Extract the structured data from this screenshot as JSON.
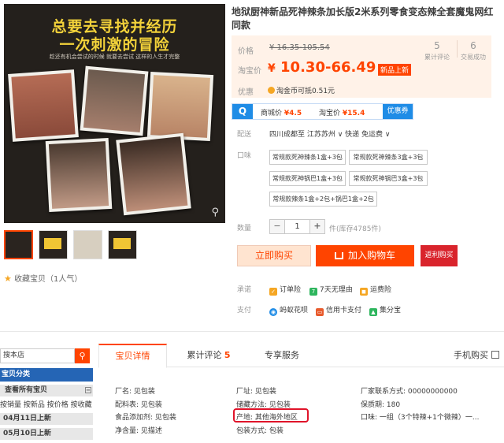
{
  "hero": {
    "line1": "总要去寻找并经历",
    "line2": "一次刺激的冒险",
    "sub": "趁还有机会尝试的时候 就要去尝试 这样的人生才完整"
  },
  "favorite": {
    "label": "收藏宝贝（1人气）"
  },
  "product": {
    "title": "地狱厨神新品死神辣条加长版2米系列零食变态辣全套魔鬼网红同款",
    "price_label": "价格",
    "original_price": "¥ 16.35-105.54",
    "promo_label": "淘宝价",
    "yen": "¥",
    "promo_price": "10.30-66.49",
    "new_badge": "新品上新",
    "offer_label": "优惠",
    "offer_text": "淘金币可抵0.51元",
    "stats": [
      {
        "num": "5",
        "label": "累计评论"
      },
      {
        "num": "6",
        "label": "交易成功"
      }
    ]
  },
  "compare": {
    "merchant_label": "商城价",
    "merchant_price": "¥4.5",
    "taobao_label": "淘宝价",
    "taobao_price": "¥15.4",
    "deal": "优惠券"
  },
  "shipping": {
    "label": "配送",
    "route": "四川成都至  江苏苏州 ∨   快递 免运费 ∨"
  },
  "flavor": {
    "label": "口味",
    "options": [
      "常规款死神辣条1盒+3包",
      "常规款死神辣条3盒+3包",
      "常规款死神锅巴1盒+3包",
      "常规款死神锅巴3盒+3包",
      "常规款辣条1盒+2包+锅巴1盒+2包"
    ]
  },
  "quantity": {
    "label": "数量",
    "minus": "−",
    "value": "1",
    "plus": "+",
    "stock": "件(库存4785件)"
  },
  "buttons": {
    "buy": "立即购买",
    "cart": "加入购物车",
    "back": "返利购买"
  },
  "promise": {
    "label": "承诺",
    "items": [
      "订单险",
      "7天无理由",
      "运费险"
    ]
  },
  "payment": {
    "label": "支付",
    "items": [
      "蚂蚁花呗",
      "信用卡支付",
      "集分宝"
    ]
  },
  "shop": {
    "search_placeholder": "搜本店",
    "search_icon": "search-icon",
    "category_header": "宝贝分类",
    "all_label": "查看所有宝贝",
    "all_toggle": "−",
    "sub_links": "按销量 按新品 按价格 按收藏",
    "dates": [
      "04月11日上新",
      "05月10日上新"
    ]
  },
  "tabs": {
    "detail": "宝贝详情",
    "reviews": "累计评论",
    "reviews_count": "5",
    "service": "专享服务",
    "mobile": "手机购买"
  },
  "attributes": [
    "厂名: 见包装",
    "厂址: 见包装",
    "厂家联系方式: 00000000000",
    "配料表: 见包装",
    "储藏方法: 见包装",
    "保质期: 180",
    "食品添加剂: 见包装",
    "产地: 其他海外地区",
    "净含量: 见描述",
    "包装方式: 包装",
    "口味: 一组（3个特辣+1个微辣）一..."
  ],
  "colors": {
    "accent": "#ff4400",
    "highlight": "#e0142a",
    "blue": "#1f8ce6"
  }
}
